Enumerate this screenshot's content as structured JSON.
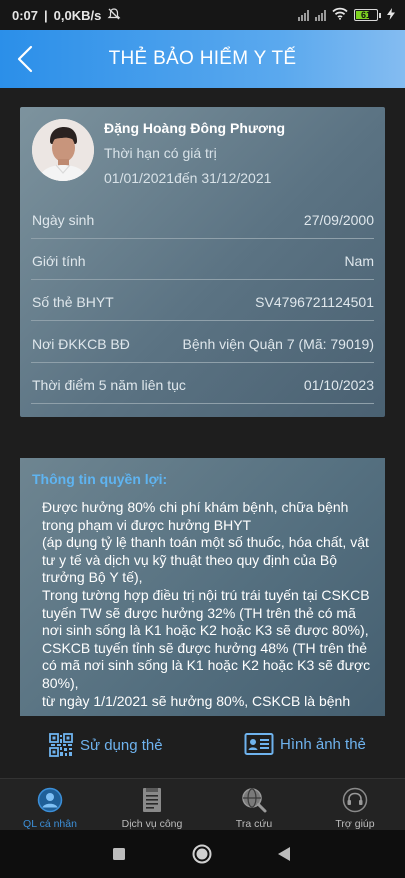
{
  "status_bar": {
    "time": "0:07",
    "network_speed": "0,0KB/s",
    "battery_level": "61",
    "icons": [
      "mute-icon",
      "signal-icon",
      "signal-icon",
      "wifi-icon",
      "battery-icon",
      "bolt-icon"
    ]
  },
  "header": {
    "title": "THẺ BẢO HIỂM Y TẾ",
    "back_icon": "chevron-left-icon"
  },
  "card": {
    "name": "Đặng Hoàng Đông Phương",
    "validity_label": "Thời hạn có giá trị",
    "validity_range": "01/01/2021đến  31/12/2021",
    "rows": [
      {
        "label": "Ngày sinh",
        "value": "27/09/2000"
      },
      {
        "label": "Giới tính",
        "value": "Nam"
      },
      {
        "label": "Số thẻ BHYT",
        "value": "SV4796721124501"
      },
      {
        "label": "Nơi ĐKKCB BĐ",
        "value": "Bệnh viện Quận 7 (Mã: 79019)"
      },
      {
        "label": "Thời điểm 5 năm liên tục",
        "value": "01/10/2023"
      }
    ]
  },
  "benefits": {
    "title": "Thông tin quyền lợi:",
    "text": "Được hưởng 80% chi phí khám bệnh, chữa bệnh trong phạm vi được hưởng BHYT\n(áp dụng tỷ lệ thanh toán một số thuốc, hóa chất, vật tư y tế và dịch vụ kỹ thuật theo quy định của Bộ trưởng Bộ Y tế),\nTrong tường hợp điều trị nội trú trái tuyến tại CSKCB tuyến TW sẽ được hưởng 32% (TH trên thẻ có mã nơi sinh sống là K1 hoặc K2 hoặc K3 sẽ được 80%),\nCSKCB tuyến tỉnh sẽ được hưởng 48% (TH trên thẻ có mã nơi sinh sống là K1 hoặc K2 hoặc K3 sẽ được 80%),\ntừ ngày 1/1/2021 sẽ hưởng 80%, CSKCB là bệnh"
  },
  "actions": {
    "use_card": {
      "label": "Sử dụng thẻ",
      "icon": "qr-code-icon"
    },
    "card_image": {
      "label": "Hình ảnh  thẻ",
      "icon": "id-card-icon"
    }
  },
  "tabs": [
    {
      "label": "QL cá nhân",
      "icon": "user-circle-icon",
      "active": true
    },
    {
      "label": "Dịch vụ công",
      "icon": "document-icon",
      "active": false
    },
    {
      "label": "Tra cứu",
      "icon": "search-globe-icon",
      "active": false
    },
    {
      "label": "Trợ giúp",
      "icon": "headset-icon",
      "active": false
    }
  ],
  "navigation": {
    "buttons": [
      "recents-icon",
      "home-icon",
      "back-icon"
    ]
  },
  "colors": {
    "header_start": "#2b8fe9",
    "header_end": "#84bcf1",
    "accent": "#6fb3ee",
    "benefits_title": "#5fb4f1",
    "active_tab": "#3c8fd8"
  }
}
